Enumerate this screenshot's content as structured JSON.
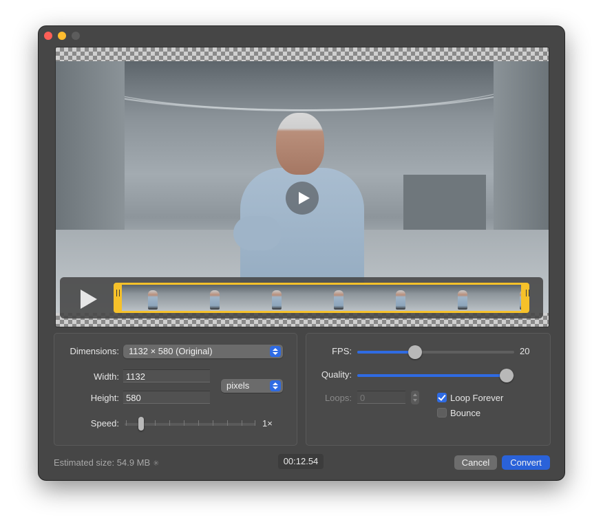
{
  "window": {
    "controls": [
      "close",
      "minimize",
      "zoom"
    ]
  },
  "preview": {
    "overlay_play_icon": "play-icon",
    "scrubber_play_icon": "play-icon",
    "frame_count": 7
  },
  "dimensions": {
    "label": "Dimensions:",
    "selected": "1132 × 580 (Original)"
  },
  "size": {
    "width_label": "Width:",
    "width_value": "1132",
    "height_label": "Height:",
    "height_value": "580",
    "unit_selected": "pixels"
  },
  "speed": {
    "label": "Speed:",
    "value_text": "1×"
  },
  "fps": {
    "label": "FPS:",
    "value": "20"
  },
  "quality": {
    "label": "Quality:"
  },
  "loops": {
    "label": "Loops:",
    "value": "0",
    "loop_forever_label": "Loop Forever",
    "loop_forever_checked": true,
    "bounce_label": "Bounce",
    "bounce_checked": false
  },
  "footer": {
    "estimated_size": "Estimated size: 54.9 MB",
    "spinner_icon": "spinner-icon",
    "duration": "00:12.54",
    "cancel_label": "Cancel",
    "convert_label": "Convert"
  },
  "colors": {
    "accent": "#2f6be3",
    "trim_handle": "#f6c12a",
    "window_bg": "#464646"
  }
}
